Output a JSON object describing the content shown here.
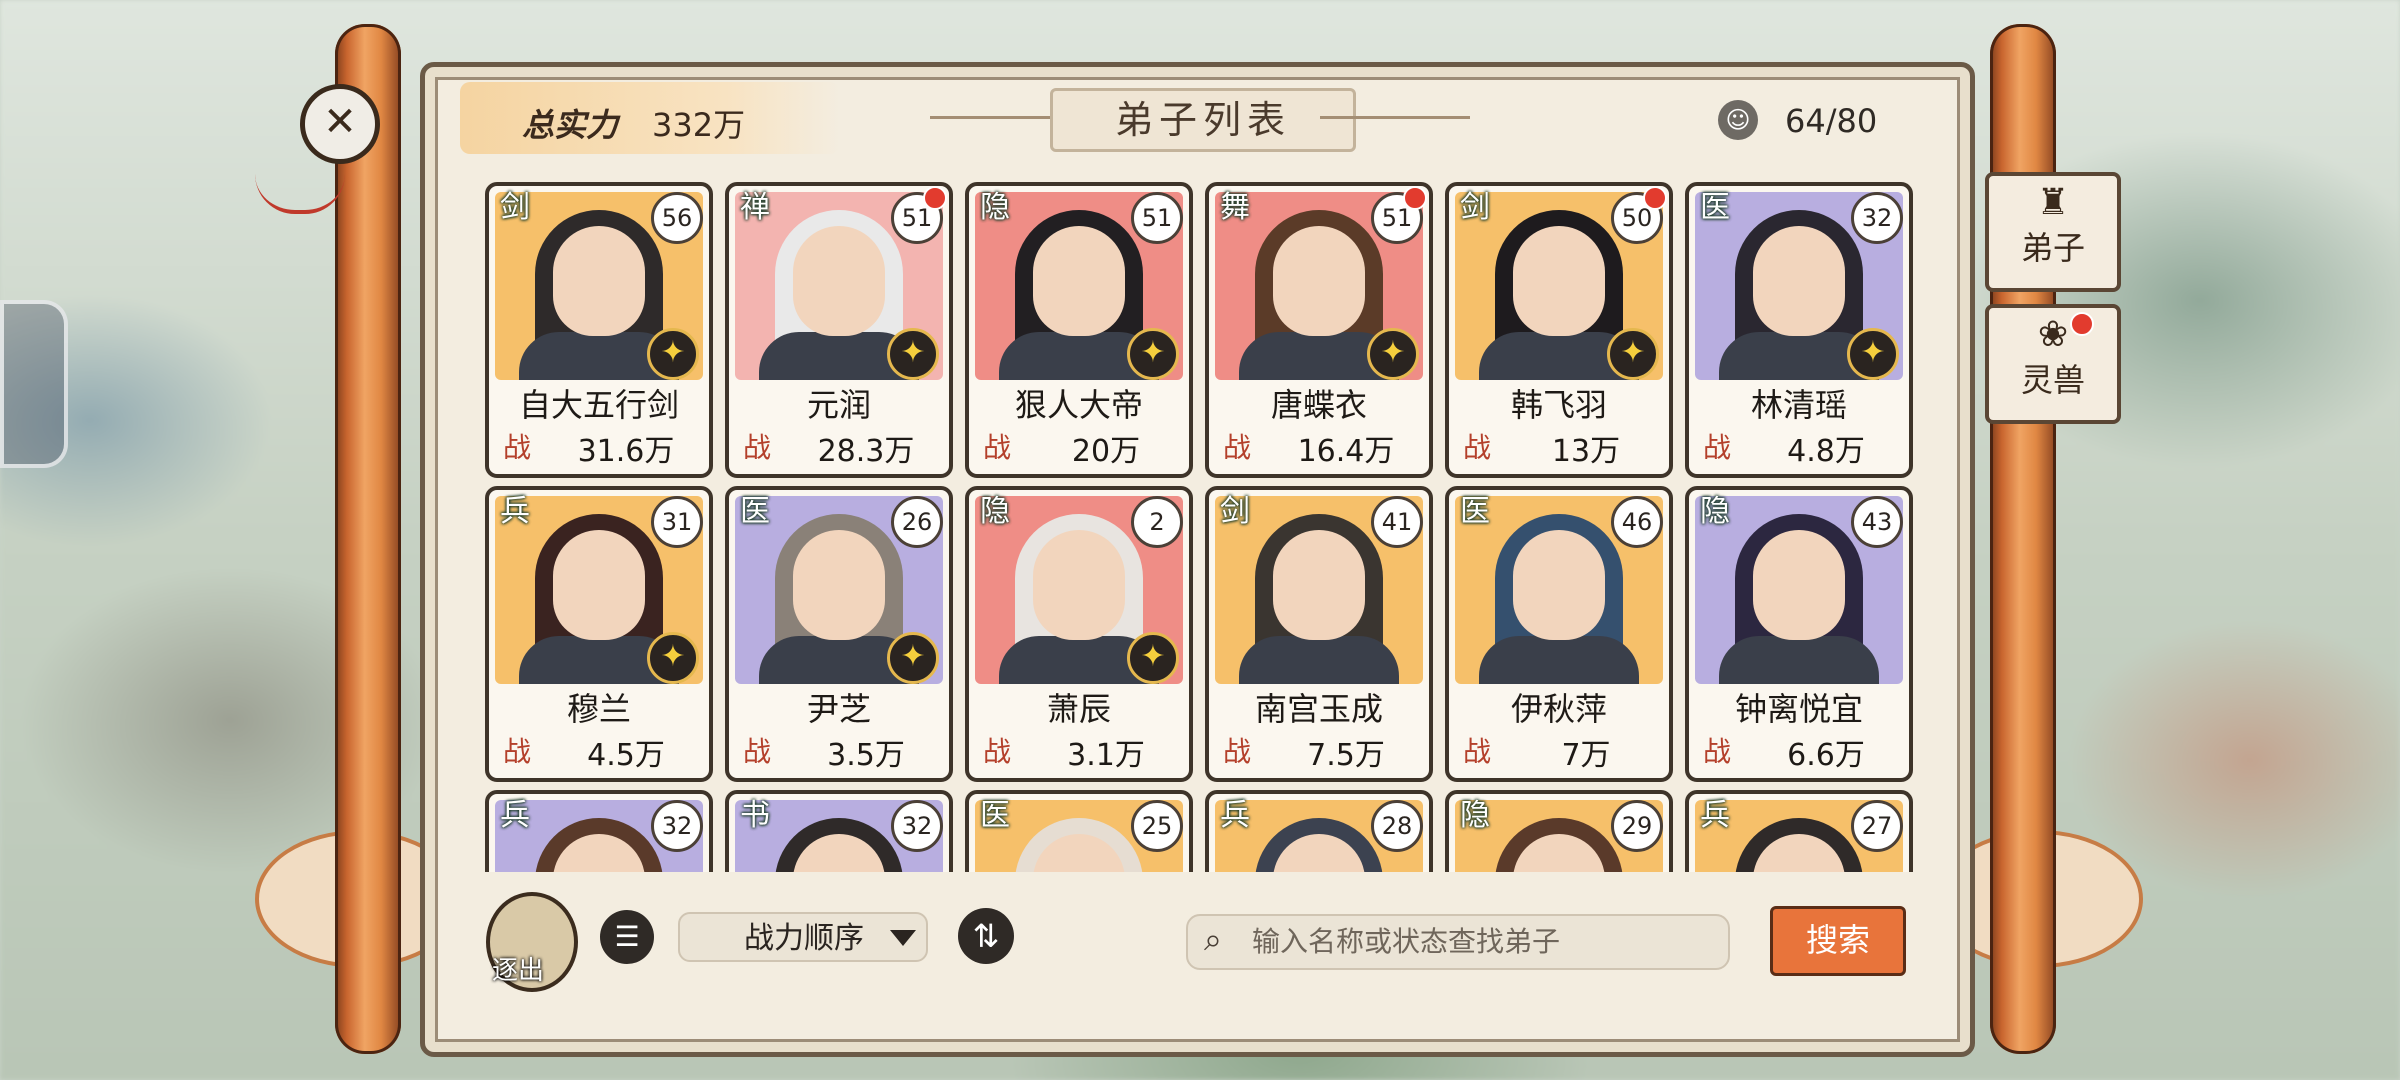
{
  "header": {
    "power_label": "总实力",
    "power_value": "332万",
    "title": "弟子列表",
    "disciple_count": "64/80"
  },
  "side_tabs": [
    {
      "label": "弟子",
      "icon": "disciple-emblem-icon",
      "alert": false
    },
    {
      "label": "灵兽",
      "icon": "beast-emblem-icon",
      "alert": true
    }
  ],
  "power_prefix": "战",
  "disciples": [
    {
      "name": "自大五行剑",
      "class": "剑",
      "level": "56",
      "power": "31.6万",
      "star": true,
      "alert": false,
      "bg": "#f6c06a",
      "hair": "#2e2a2a"
    },
    {
      "name": "元润",
      "class": "禅",
      "level": "51",
      "power": "28.3万",
      "star": true,
      "alert": true,
      "bg": "#f3b4b0",
      "hair": "#e9e9e9"
    },
    {
      "name": "狠人大帝",
      "class": "隐",
      "level": "51",
      "power": "20万",
      "star": true,
      "alert": false,
      "bg": "#ef8d86",
      "hair": "#221f22"
    },
    {
      "name": "唐蝶衣",
      "class": "舞",
      "level": "51",
      "power": "16.4万",
      "star": true,
      "alert": true,
      "bg": "#ef8d86",
      "hair": "#5b3b28"
    },
    {
      "name": "韩飞羽",
      "class": "剑",
      "level": "50",
      "power": "13万",
      "star": true,
      "alert": true,
      "bg": "#f6c06a",
      "hair": "#1e1b1e"
    },
    {
      "name": "林清瑶",
      "class": "医",
      "level": "32",
      "power": "4.8万",
      "star": true,
      "alert": false,
      "bg": "#b8aee0",
      "hair": "#2a2730"
    },
    {
      "name": "穆兰",
      "class": "兵",
      "level": "31",
      "power": "4.5万",
      "star": true,
      "alert": false,
      "bg": "#f6c06a",
      "hair": "#3a2320"
    },
    {
      "name": "尹芝",
      "class": "医",
      "level": "26",
      "power": "3.5万",
      "star": true,
      "alert": false,
      "bg": "#b8aee0",
      "hair": "#8a8178"
    },
    {
      "name": "萧辰",
      "class": "隐",
      "level": "2",
      "power": "3.1万",
      "star": true,
      "alert": false,
      "bg": "#ef8d86",
      "hair": "#e8e4e0"
    },
    {
      "name": "南宫玉成",
      "class": "剑",
      "level": "41",
      "power": "7.5万",
      "star": false,
      "alert": false,
      "bg": "#f6c06a",
      "hair": "#3a3530"
    },
    {
      "name": "伊秋萍",
      "class": "医",
      "level": "46",
      "power": "7万",
      "star": false,
      "alert": false,
      "bg": "#f6c06a",
      "hair": "#35506e"
    },
    {
      "name": "钟离悦宜",
      "class": "隐",
      "level": "43",
      "power": "6.6万",
      "star": false,
      "alert": false,
      "bg": "#b8aee0",
      "hair": "#2c2740"
    },
    {
      "name": "",
      "class": "兵",
      "level": "32",
      "power": "",
      "star": false,
      "alert": false,
      "bg": "#b8aee0",
      "hair": "#5a3a2a"
    },
    {
      "name": "",
      "class": "书",
      "level": "32",
      "power": "",
      "star": false,
      "alert": false,
      "bg": "#b8aee0",
      "hair": "#2f2a29"
    },
    {
      "name": "",
      "class": "医",
      "level": "25",
      "power": "",
      "star": false,
      "alert": false,
      "bg": "#f6c06a",
      "hair": "#e6ddd2"
    },
    {
      "name": "",
      "class": "兵",
      "level": "28",
      "power": "",
      "star": false,
      "alert": false,
      "bg": "#f6c06a",
      "hair": "#3c4250"
    },
    {
      "name": "",
      "class": "隐",
      "level": "29",
      "power": "",
      "star": false,
      "alert": false,
      "bg": "#f6c06a",
      "hair": "#5a3a2a"
    },
    {
      "name": "",
      "class": "兵",
      "level": "27",
      "power": "",
      "star": false,
      "alert": false,
      "bg": "#f6c06a",
      "hair": "#2f2a29"
    }
  ],
  "toolbar": {
    "expel_label": "逐出",
    "sort_label": "战力顺序",
    "search_placeholder": "输入名称或状态查找弟子",
    "search_label": "搜索"
  },
  "colors": {
    "accent": "#e8743b",
    "frame": "#c9652e",
    "power_prefix": "#b4402b"
  }
}
